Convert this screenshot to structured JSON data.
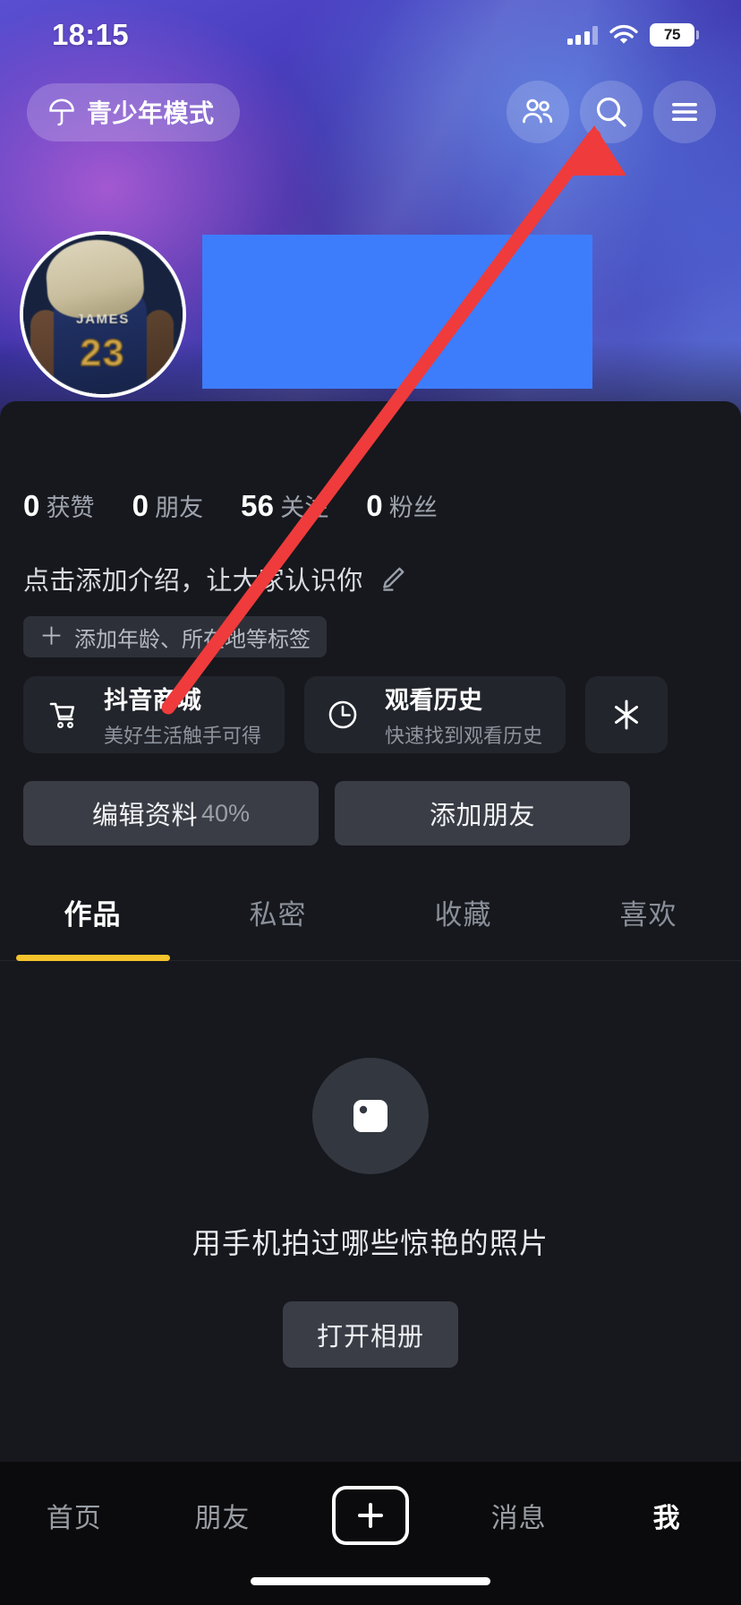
{
  "status_bar": {
    "time": "18:15",
    "battery_percent": "75",
    "icons": [
      "cellular-signal-icon",
      "wifi-icon",
      "battery-icon"
    ]
  },
  "top_bar": {
    "teen_mode": {
      "label": "青少年模式",
      "icon": "umbrella-icon"
    },
    "actions": [
      {
        "name": "friends-icon",
        "label": ""
      },
      {
        "name": "search-icon",
        "label": ""
      },
      {
        "name": "menu-icon",
        "label": ""
      }
    ]
  },
  "profile": {
    "avatar": {
      "jersey_name": "JAMES",
      "jersey_number": "23"
    },
    "name_redacted": true,
    "stats": [
      {
        "value": "0",
        "label": "获赞"
      },
      {
        "value": "0",
        "label": "朋友"
      },
      {
        "value": "56",
        "label": "关注"
      },
      {
        "value": "0",
        "label": "粉丝"
      }
    ],
    "bio_placeholder": "点击添加介绍，让大家认识你",
    "bio_edit_icon": "pencil-icon",
    "tag_button": {
      "plus": "＋",
      "label": "添加年龄、所在地等标签"
    }
  },
  "shortcut_cards": [
    {
      "icon": "shopping-cart-icon",
      "title": "抖音商城",
      "subtitle": "美好生活触手可得"
    },
    {
      "icon": "clock-icon",
      "title": "观看历史",
      "subtitle": "快速找到观看历史"
    },
    {
      "icon": "douyin-star-icon",
      "title": "",
      "subtitle": ""
    }
  ],
  "action_buttons": {
    "edit_profile": {
      "label": "编辑资料",
      "progress": "40%"
    },
    "add_friend": {
      "label": "添加朋友"
    }
  },
  "tabs": [
    {
      "label": "作品",
      "active": true
    },
    {
      "label": "私密",
      "active": false
    },
    {
      "label": "收藏",
      "active": false
    },
    {
      "label": "喜欢",
      "active": false
    }
  ],
  "empty_state": {
    "icon": "photo-icon",
    "title": "用手机拍过哪些惊艳的照片",
    "button_label": "打开相册"
  },
  "bottom_nav": [
    {
      "label": "首页",
      "active": false
    },
    {
      "label": "朋友",
      "active": false
    },
    {
      "label": "",
      "active": false,
      "icon": "plus-icon"
    },
    {
      "label": "消息",
      "active": false
    },
    {
      "label": "我",
      "active": true
    }
  ],
  "colors": {
    "accent_yellow": "#f5c32c",
    "redaction_blue": "#3d7dfb",
    "annotation_red": "#ef3b3b",
    "surface": "#16181d",
    "card": "#22252c",
    "button": "#3a3d45"
  }
}
